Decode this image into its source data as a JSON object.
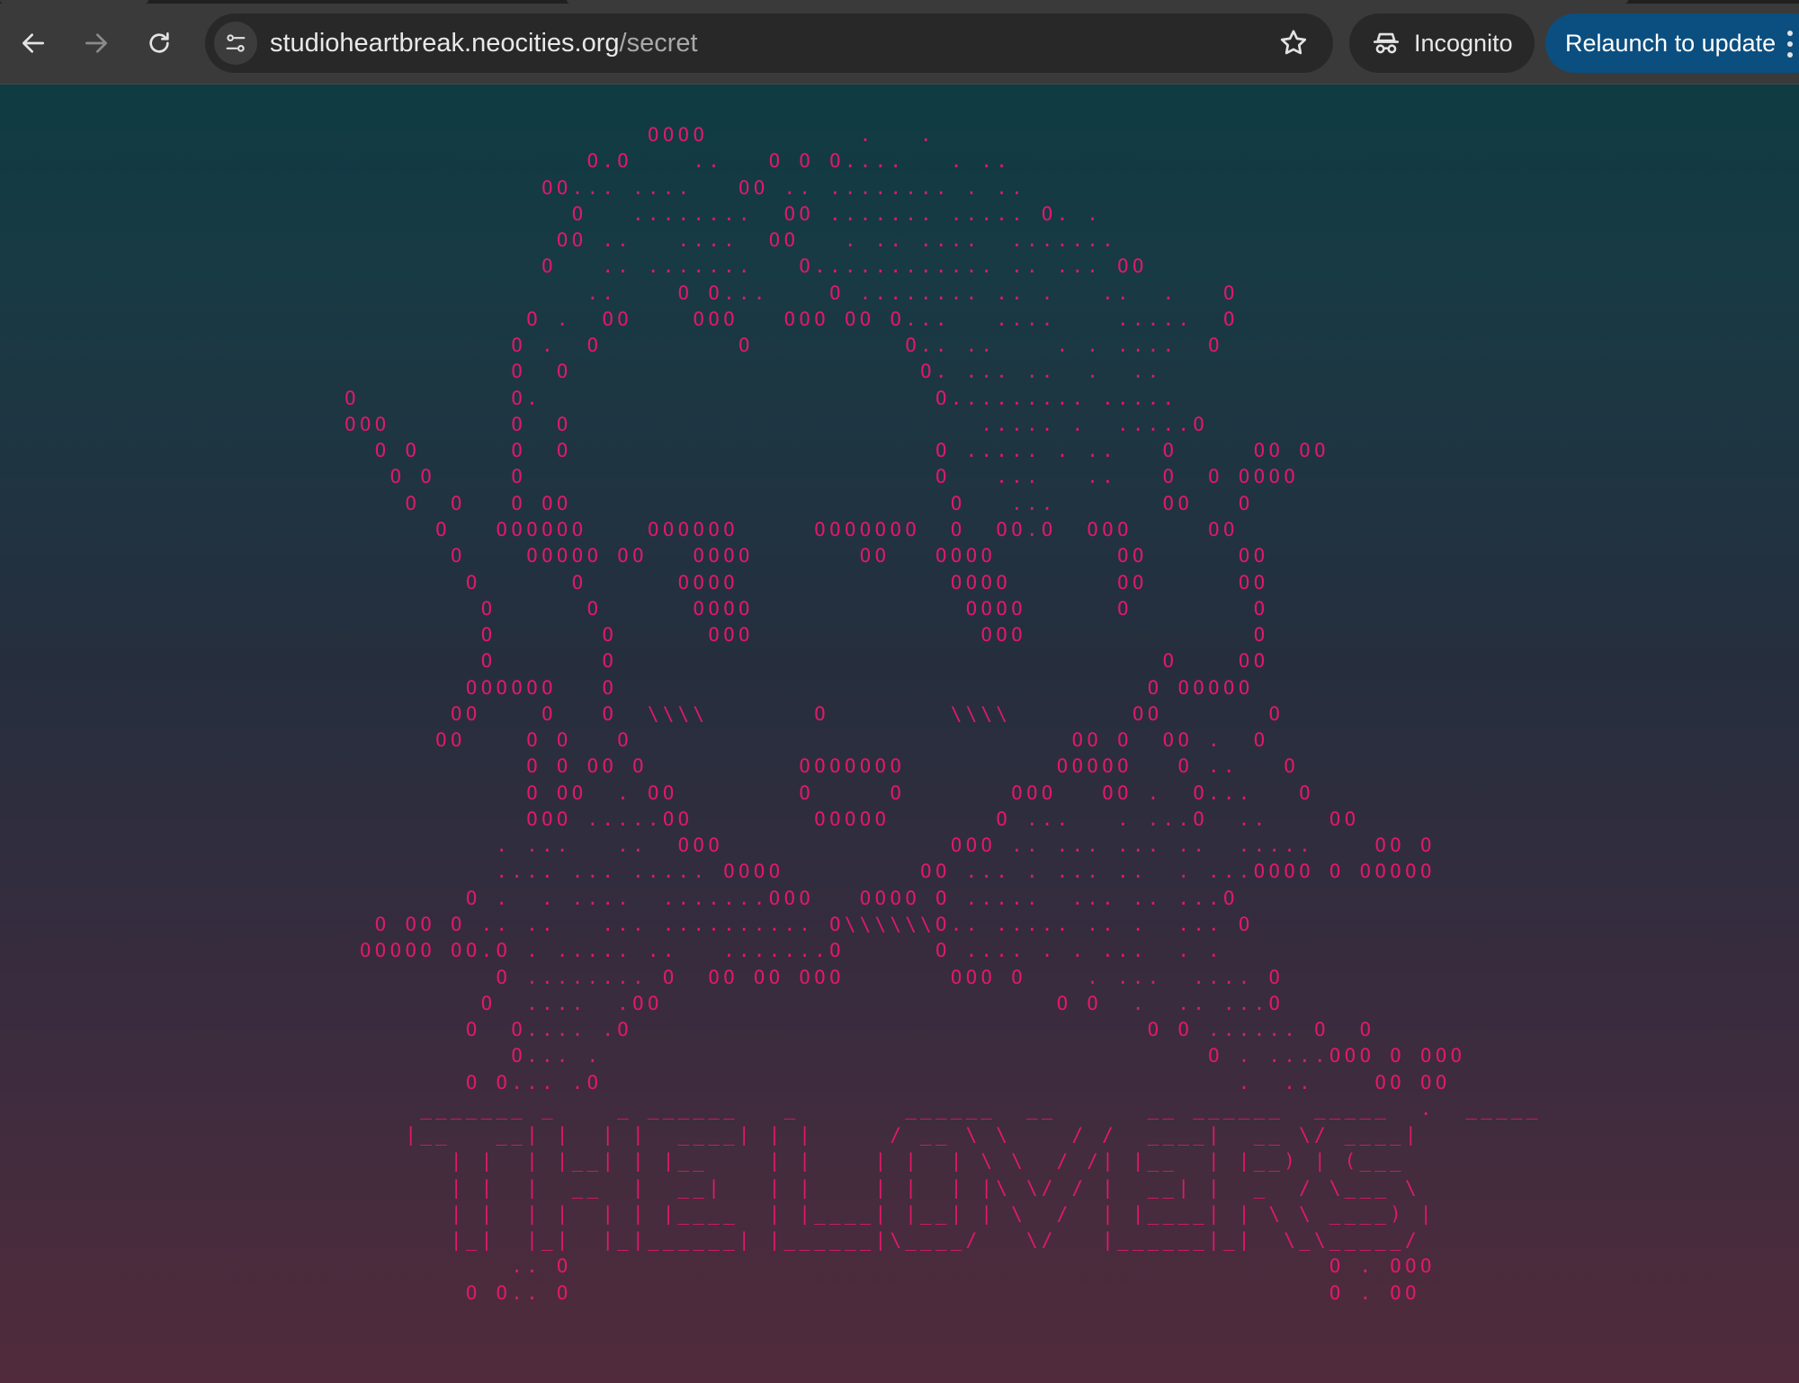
{
  "browser": {
    "url_host": "studioheartbreak.neocities.org",
    "url_path": "/secret",
    "incognito_label": "Incognito",
    "relaunch_label": "Relaunch to update",
    "icons": {
      "back": "back-arrow-icon",
      "forward": "forward-arrow-icon",
      "reload": "reload-icon",
      "site_info": "tune-icon",
      "bookmark": "star-icon",
      "incognito": "incognito-icon",
      "menu": "three-dot-menu-icon"
    }
  },
  "colors": {
    "ascii_text": "#e0196a",
    "background_top": "#0f3b43",
    "background_bottom": "#512b3c",
    "relaunch_button": "#0b4f80"
  },
  "page": {
    "ascii_art": "                    OOOO          .   .\n                O.O    ..   O O O....   . ..\n             OO... ....   OO .. ........ . ..\n               O   ........  OO ....... ..... O. .\n              OO ..   ....  OO   . .. ....  .......\n             O   .. .......   O............ .. ... OO\n                ..    O O...    O ........ .. .   ..  .   O\n            O .  OO    OOO   OOO OO O...   ....    .....  O\n           O .  O         O          O.. ..    . . ....  O\n           O  O                       O. ... ..  .  ..\nO          O.                          O......... .....\nOOO        O  O                           ..... .  .....O\n  O O      O  O                        O ..... . ..   O     OO OO\n   O O     O                           O   ...   ..   O  O OOOO\n    O  O   O OO                         O   ...       OO   O\n      O   OOOOOO    OOOOOO     OOOOOOO  O  OO.O  OOO     OO\n       O    OOOOO OO   OOOO       OO   OOOO        OO      OO\n        O      O      OOOO              OOOO       OO      OO\n         O      O      OOOO              OOOO      O        O\n         O       O      OOO               OOO               O\n         O       O                                    O    OO\n        OOOOOO   O                                   O OOOOO\n       OO    O   O  \\\\\\\\       O        \\\\\\\\        OO       O\n      OO    O O   O                             OO O  OO .  O\n            O O OO O          OOOOOOO          OOOOO   O ..   O\n            O OO  . OO        O     O       OOO   OO .  O...   O\n            OOO .....OO        OOOOO       O ...   . ...O  ..    OO\n          . ...   ..  OOO               OOO .. ... ... ..  .....    OO O\n          .... ... ..... OOOO         OO ... . ... ..  . ...OOOO O OOOOO\n        O .  . ....  .......OOO   OOOO O .....  ... .. ...O\n  O OO O .. ..   ... .......... O\\\\\\\\\\\\O.. ..... .. .  ... O\n OOOOO OO.O . ..... ..   .......O      O .... . . ...  . .\n          O ........ O  OO OO OOO       OOO O    . ...  .... O\n         O  ....  .OO                          O O  .  .. ...O\n        O  O.... .O                                  O O ...... O  O\n           O... .                                        O . ....OOO O OOO\n        O O... .O                                          .  ..    OO OO\n     _______ _    _ ______   _       ______  __      __ ______  _____  .  _____\n    |__   __| |  | |  ____| | |     / __ \\ \\    / /  ____|  __ \\/ ____|\n       | |  | |__| | |__    | |    | |  | \\ \\  / /| |__  | |__) | (___\n       | |  |  __  |  __|   | |    | |  | |\\ \\/ / |  __| |  _  / \\___ \\\n       | |  | |  | | |____  | |____| |__| | \\  /  | |____| | \\ \\ ____) |\n       |_|  |_|  |_|______| |______|\\____/   \\/   |______|_|  \\_\\_____/\n           .. O                                                  O . OOO\n        O O.. O                                                  O . OO"
  }
}
